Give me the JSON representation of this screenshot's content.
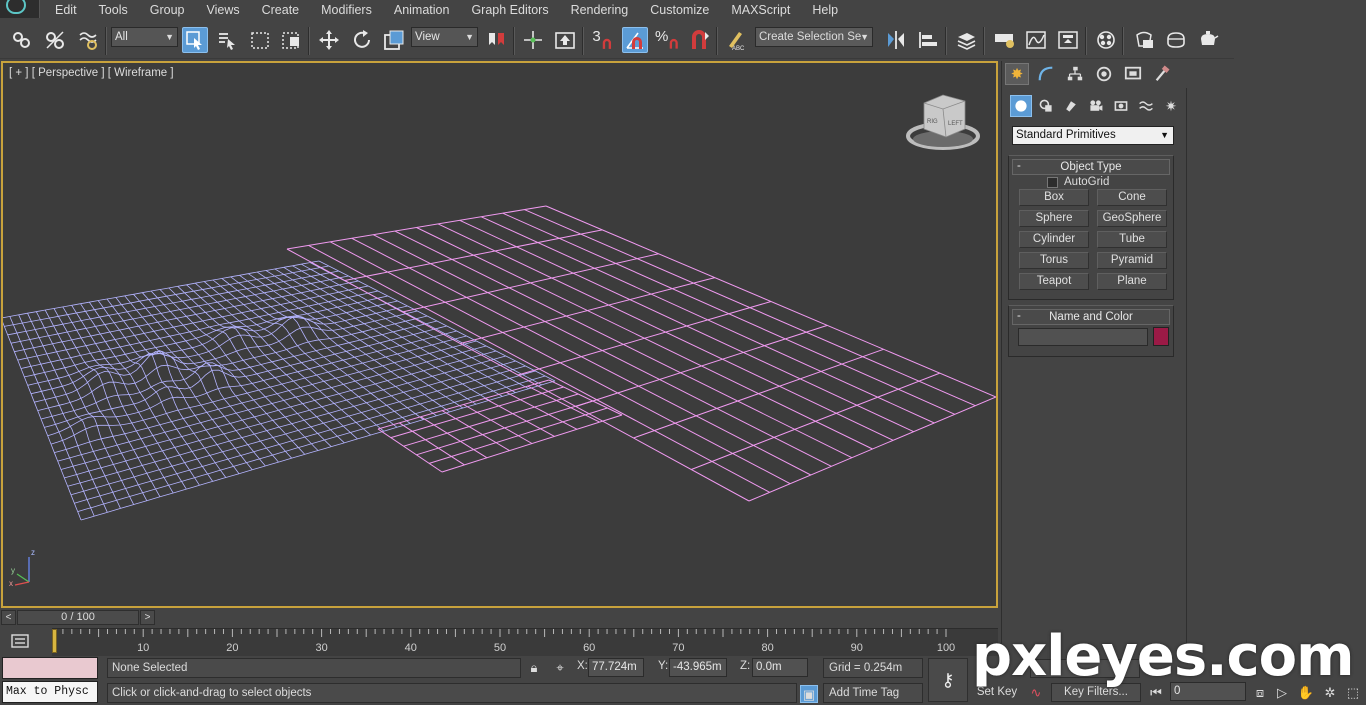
{
  "menu": {
    "items": [
      "Edit",
      "Tools",
      "Group",
      "Views",
      "Create",
      "Modifiers",
      "Animation",
      "Graph Editors",
      "Rendering",
      "Customize",
      "MAXScript",
      "Help"
    ]
  },
  "toolbar": {
    "selection_filter": "All",
    "reference_coord": "View",
    "named_selection_placeholder": "Create Selection Se",
    "snap_label": "3",
    "percent_snap_label": "%"
  },
  "viewport": {
    "label": "[ + ] [ Perspective ] [ Wireframe ]",
    "cube_face_left": "RIG",
    "cube_face_front": "LEFT",
    "axis_z": "z",
    "axis_y": "y",
    "axis_x": "x"
  },
  "command_panel": {
    "category_dropdown": "Standard Primitives",
    "object_type": {
      "title": "Object Type",
      "autogrid_label": "AutoGrid",
      "autogrid_checked": false,
      "buttons": [
        "Box",
        "Cone",
        "Sphere",
        "GeoSphere",
        "Cylinder",
        "Tube",
        "Torus",
        "Pyramid",
        "Teapot",
        "Plane"
      ]
    },
    "name_and_color": {
      "title": "Name and Color",
      "name_value": "",
      "color": "#9b1a46"
    }
  },
  "time_slider": {
    "frame_display": "0 / 100",
    "left_arrow": "<",
    "right_arrow": ">"
  },
  "track_bar": {
    "current_frame": 0,
    "tick_labels": [
      "0",
      "10",
      "20",
      "30",
      "40",
      "50",
      "60",
      "70",
      "80",
      "90",
      "100"
    ]
  },
  "status": {
    "maxscript_listener": "Max to Physc",
    "selection_status": "None Selected",
    "prompt": "Click or click-and-drag to select objects",
    "x_label": "X:",
    "x_value": "77.724m",
    "y_label": "Y:",
    "y_value": "-43.965m",
    "z_label": "Z:",
    "z_value": "0.0m",
    "grid": "Grid = 0.254m",
    "add_time_tag": "Add Time Tag",
    "set_key": "Set Key",
    "key_filters": "Key Filters...",
    "current_frame_field": "0"
  },
  "watermark": "pxleyes.com",
  "colors": {
    "viewport_border": "#c8a23c",
    "terrain_wire": "#b4b4ff",
    "plane_wire": "#f09af0",
    "active_tool": "#5b9bd5"
  }
}
